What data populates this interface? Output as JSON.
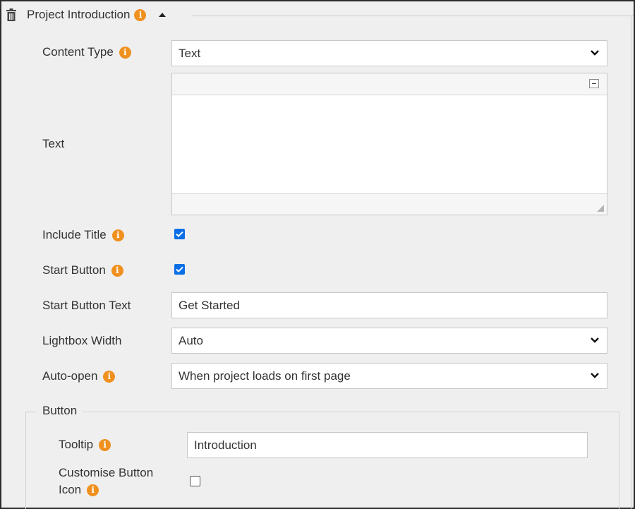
{
  "header": {
    "title": "Project Introduction",
    "trash_icon": "trash-icon",
    "info_icon": "info-icon",
    "collapse_icon": "caret-up-icon"
  },
  "colors": {
    "info_badge": "#f0901e",
    "checkbox_checked": "#0a6ee6",
    "panel_bg": "#efefef"
  },
  "form": {
    "content_type": {
      "label": "Content Type",
      "value": "Text"
    },
    "text": {
      "label": "Text",
      "value": ""
    },
    "include_title": {
      "label": "Include Title",
      "checked": true
    },
    "start_button": {
      "label": "Start Button",
      "checked": true
    },
    "start_button_text": {
      "label": "Start Button Text",
      "value": "Get Started"
    },
    "lightbox_width": {
      "label": "Lightbox Width",
      "value": "Auto"
    },
    "auto_open": {
      "label": "Auto-open",
      "value": "When project loads on first page"
    }
  },
  "button_group": {
    "legend": "Button",
    "tooltip": {
      "label": "Tooltip",
      "value": "Introduction"
    },
    "customise_icon": {
      "label_line1": "Customise Button",
      "label_line2": "Icon",
      "checked": false
    }
  }
}
